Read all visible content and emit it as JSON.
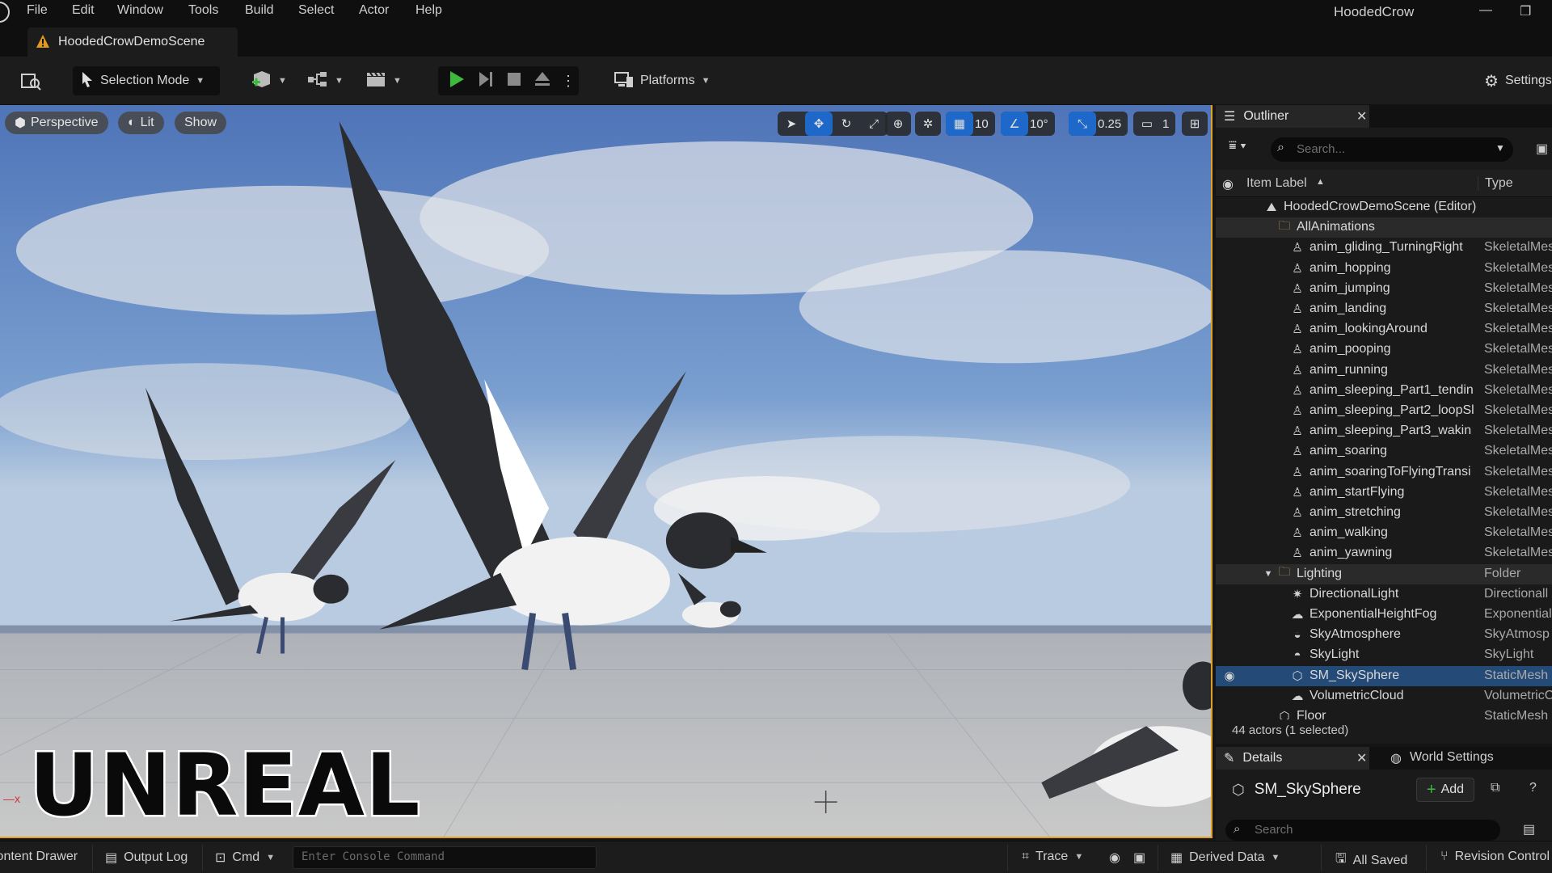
{
  "menubar": {
    "items": [
      "File",
      "Edit",
      "Window",
      "Tools",
      "Build",
      "Select",
      "Actor",
      "Help"
    ],
    "app_title": "HoodedCrow"
  },
  "tab": {
    "label": "HoodedCrowDemoScene"
  },
  "toolbar": {
    "selection_mode": "Selection Mode",
    "platforms": "Platforms",
    "settings": "Settings"
  },
  "viewport": {
    "perspective": "Perspective",
    "lit": "Lit",
    "show": "Show",
    "grid_snap": "10",
    "angle_snap": "10°",
    "scale_snap": "0.25",
    "camera_speed": "1",
    "logo_text": "UNREAL"
  },
  "outliner": {
    "tab_label": "Outliner",
    "search_placeholder": "Search...",
    "col_label": "Item Label",
    "col_type": "Type",
    "rows": [
      {
        "name": "HoodedCrowDemoScene (Editor)",
        "type": "",
        "icon": "level-icon"
      },
      {
        "name": "AllAnimations",
        "type": "",
        "icon": "folder-icon"
      },
      {
        "name": "anim_gliding_TurningRight",
        "type": "SkeletalMes",
        "icon": "skeletal-mesh-icon"
      },
      {
        "name": "anim_hopping",
        "type": "SkeletalMes",
        "icon": "skeletal-mesh-icon"
      },
      {
        "name": "anim_jumping",
        "type": "SkeletalMes",
        "icon": "skeletal-mesh-icon"
      },
      {
        "name": "anim_landing",
        "type": "SkeletalMes",
        "icon": "skeletal-mesh-icon"
      },
      {
        "name": "anim_lookingAround",
        "type": "SkeletalMes",
        "icon": "skeletal-mesh-icon"
      },
      {
        "name": "anim_pooping",
        "type": "SkeletalMes",
        "icon": "skeletal-mesh-icon"
      },
      {
        "name": "anim_running",
        "type": "SkeletalMes",
        "icon": "skeletal-mesh-icon"
      },
      {
        "name": "anim_sleeping_Part1_tendin",
        "type": "SkeletalMes",
        "icon": "skeletal-mesh-icon"
      },
      {
        "name": "anim_sleeping_Part2_loopSl",
        "type": "SkeletalMes",
        "icon": "skeletal-mesh-icon"
      },
      {
        "name": "anim_sleeping_Part3_wakin",
        "type": "SkeletalMes",
        "icon": "skeletal-mesh-icon"
      },
      {
        "name": "anim_soaring",
        "type": "SkeletalMes",
        "icon": "skeletal-mesh-icon"
      },
      {
        "name": "anim_soaringToFlyingTransi",
        "type": "SkeletalMes",
        "icon": "skeletal-mesh-icon"
      },
      {
        "name": "anim_startFlying",
        "type": "SkeletalMes",
        "icon": "skeletal-mesh-icon"
      },
      {
        "name": "anim_stretching",
        "type": "SkeletalMes",
        "icon": "skeletal-mesh-icon"
      },
      {
        "name": "anim_walking",
        "type": "SkeletalMes",
        "icon": "skeletal-mesh-icon"
      },
      {
        "name": "anim_yawning",
        "type": "SkeletalMes",
        "icon": "skeletal-mesh-icon"
      },
      {
        "name": "Lighting",
        "type": "Folder",
        "icon": "folder-icon"
      },
      {
        "name": "DirectionalLight",
        "type": "Directionall",
        "icon": "sun-icon"
      },
      {
        "name": "ExponentialHeightFog",
        "type": "Exponential",
        "icon": "fog-icon"
      },
      {
        "name": "SkyAtmosphere",
        "type": "SkyAtmosp",
        "icon": "atmosphere-icon"
      },
      {
        "name": "SkyLight",
        "type": "SkyLight",
        "icon": "skylight-icon"
      },
      {
        "name": "SM_SkySphere",
        "type": "StaticMesh",
        "icon": "static-mesh-icon"
      },
      {
        "name": "VolumetricCloud",
        "type": "VolumetricC",
        "icon": "cloud-icon"
      },
      {
        "name": "Floor",
        "type": "StaticMesh",
        "icon": "static-mesh-icon"
      }
    ],
    "status": "44 actors (1 selected)"
  },
  "details": {
    "tab_label": "Details",
    "world_settings": "World Settings",
    "actor_name": "SM_SkySphere",
    "add_label": "Add",
    "search_placeholder": "Search"
  },
  "bottombar": {
    "content_drawer": "Content Drawer",
    "output_log": "Output Log",
    "cmd": "Cmd",
    "console_placeholder": "Enter Console Command",
    "trace": "Trace",
    "derived_data": "Derived Data",
    "all_saved": "All Saved",
    "revision_control": "Revision Control"
  }
}
